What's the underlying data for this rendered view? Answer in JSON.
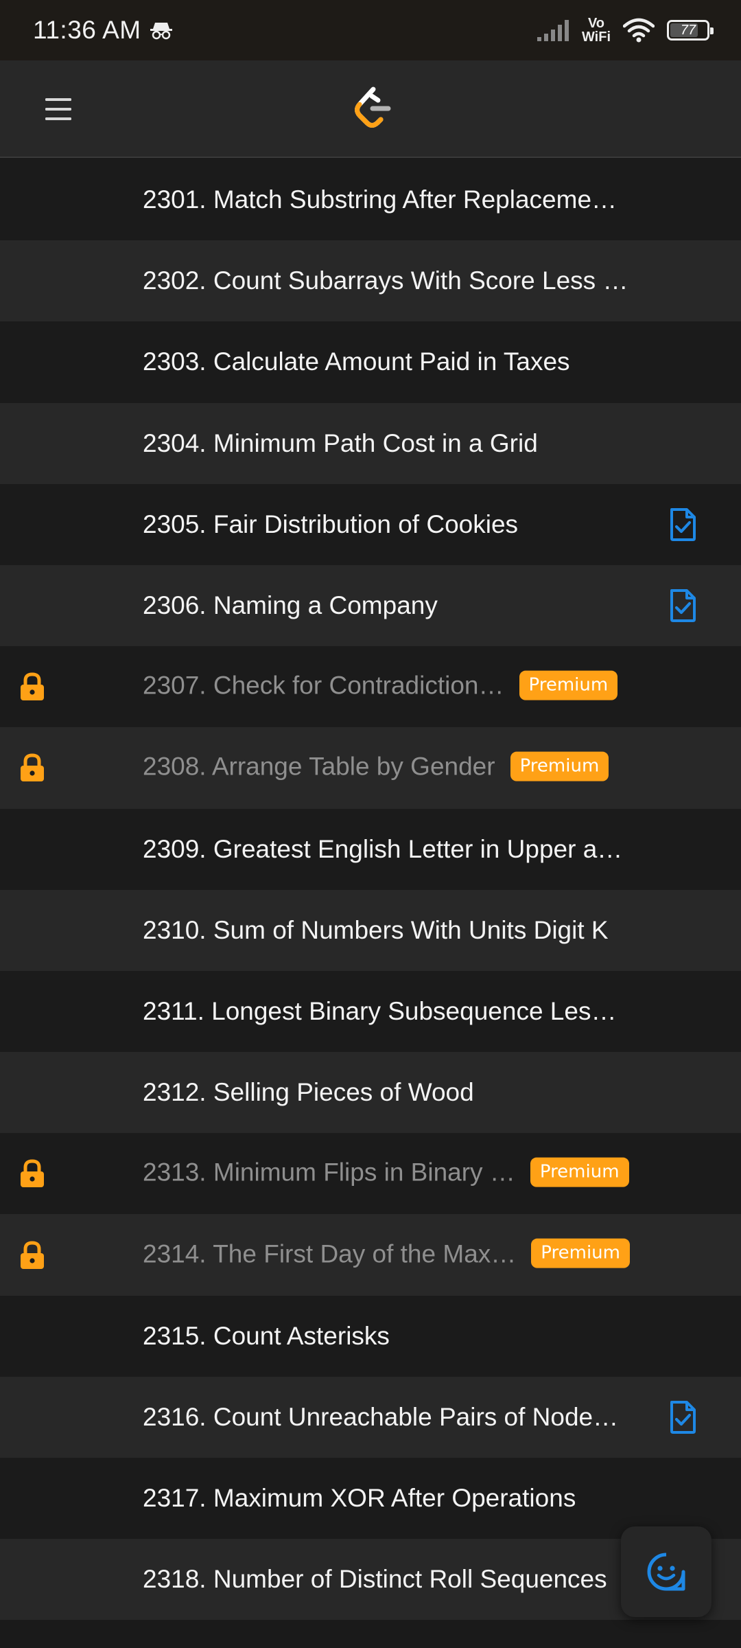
{
  "status_bar": {
    "time": "11:36 AM",
    "vowifi_top": "Vo",
    "vowifi_bottom": "WiFi",
    "battery": "77",
    "battery_level": 0.77
  },
  "header": {
    "menu_icon": "hamburger-menu-icon",
    "logo_icon": "leetcode-logo"
  },
  "problems": [
    {
      "title": "2301. Match Substring After Replaceme…",
      "locked": false,
      "premium": "",
      "solved": false
    },
    {
      "title": "2302. Count Subarrays With Score Less …",
      "locked": false,
      "premium": "",
      "solved": false
    },
    {
      "title": "2303. Calculate Amount Paid in Taxes",
      "locked": false,
      "premium": "",
      "solved": false
    },
    {
      "title": "2304. Minimum Path Cost in a Grid",
      "locked": false,
      "premium": "",
      "solved": false
    },
    {
      "title": "2305. Fair Distribution of Cookies",
      "locked": false,
      "premium": "",
      "solved": true
    },
    {
      "title": "2306. Naming a Company",
      "locked": false,
      "premium": "",
      "solved": true
    },
    {
      "title": "2307. Check for Contradiction…",
      "locked": true,
      "premium": "Premium",
      "solved": false
    },
    {
      "title": "2308. Arrange Table by Gender",
      "locked": true,
      "premium": "Premium",
      "solved": false
    },
    {
      "title": "2309. Greatest English Letter in Upper a…",
      "locked": false,
      "premium": "",
      "solved": false
    },
    {
      "title": "2310. Sum of Numbers With Units Digit K",
      "locked": false,
      "premium": "",
      "solved": false
    },
    {
      "title": "2311. Longest Binary Subsequence Les…",
      "locked": false,
      "premium": "",
      "solved": false
    },
    {
      "title": "2312. Selling Pieces of Wood",
      "locked": false,
      "premium": "",
      "solved": false
    },
    {
      "title": "2313. Minimum Flips in Binary …",
      "locked": true,
      "premium": "Premium",
      "solved": false
    },
    {
      "title": "2314. The First Day of the Max…",
      "locked": true,
      "premium": "Premium",
      "solved": false
    },
    {
      "title": "2315. Count Asterisks",
      "locked": false,
      "premium": "",
      "solved": false
    },
    {
      "title": "2316. Count Unreachable Pairs of Node…",
      "locked": false,
      "premium": "",
      "solved": true
    },
    {
      "title": "2317. Maximum XOR After Operations",
      "locked": false,
      "premium": "",
      "solved": false
    },
    {
      "title": "2318. Number of Distinct Roll Sequences",
      "locked": false,
      "premium": "",
      "solved": false
    }
  ],
  "colors": {
    "premium": "#ffa116",
    "lock": "#ffa116",
    "solved": "#1e88e5",
    "row_odd": "#1b1b1b",
    "row_even": "#282828"
  },
  "feedback": {
    "icon": "smiley-feedback-icon"
  }
}
